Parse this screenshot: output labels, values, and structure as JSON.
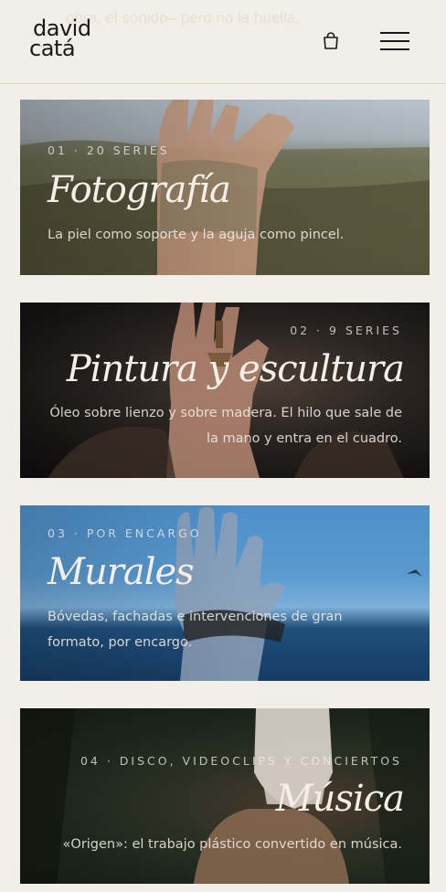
{
  "header": {
    "ghost_text": "obra, el sonido– pero no la huella.",
    "logo_line1": "david",
    "logo_line2": "catá"
  },
  "cards": [
    {
      "meta": "01 · 20 SERIES",
      "title": "Fotografía",
      "description": "La piel como soporte y la aguja como pincel."
    },
    {
      "meta": "02 · 9 SERIES",
      "title": "Pintura y escultura",
      "description_line1": "Óleo sobre lienzo y sobre madera. El hilo que sale de",
      "description_line2": "la mano y entra en el cuadro."
    },
    {
      "meta": "03 · POR ENCARGO",
      "title": "Murales",
      "description_line1": "Bóvedas, fachadas e intervenciones de gran",
      "description_line2": "formato, por encargo."
    },
    {
      "meta": "04 · DISCO, VIDEOCLIPS Y CONCIERTOS",
      "title": "Música",
      "description": "«Origen»: el trabajo plástico convertido en música."
    }
  ],
  "icons": [
    "cart-icon",
    "menu-icon"
  ]
}
